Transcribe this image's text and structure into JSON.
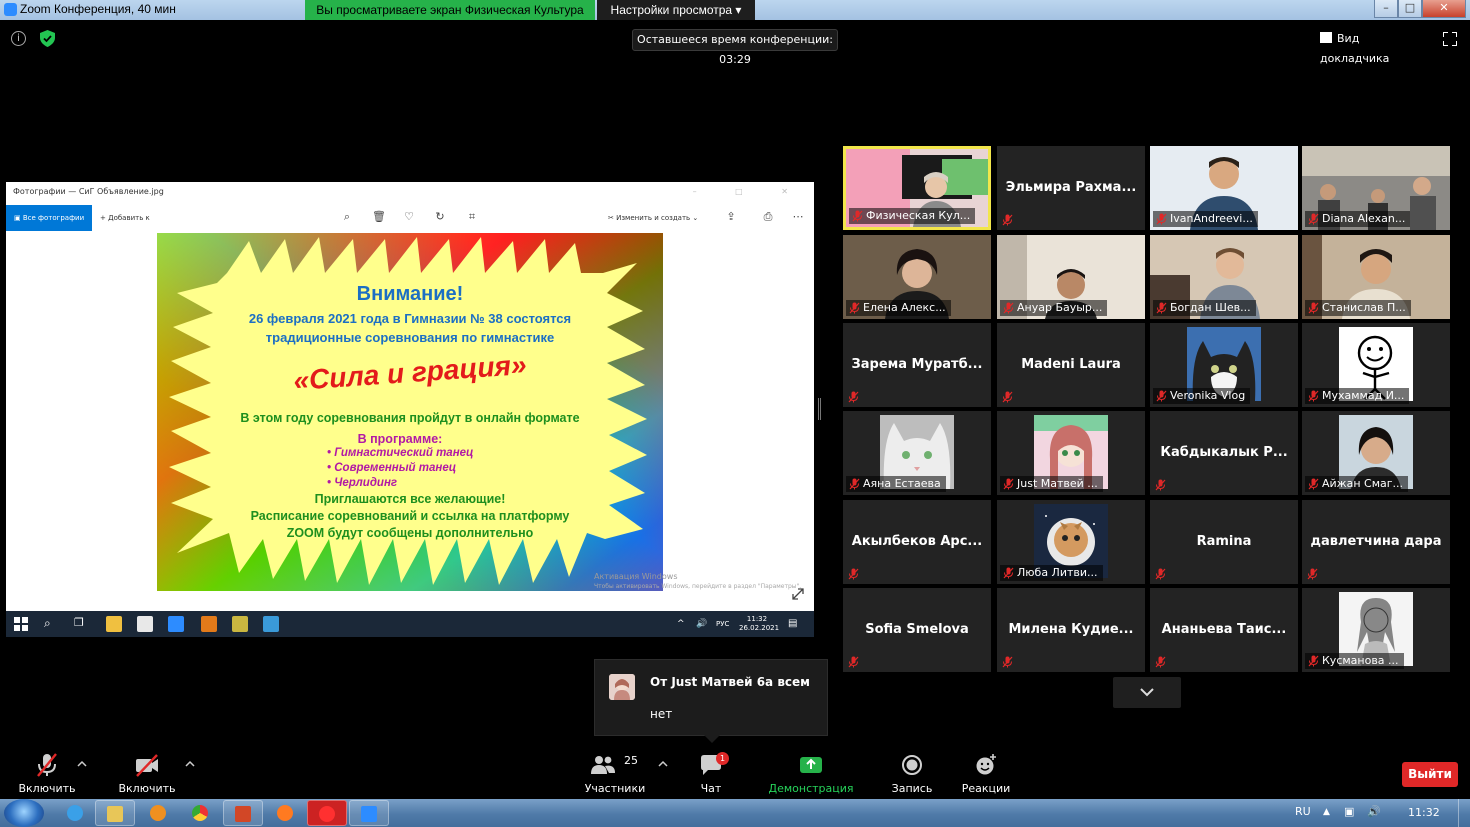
{
  "window": {
    "title": "Zoom Конференция, 40 мин",
    "share_banner": "Вы просматриваете экран Физическая Культура",
    "view_options": "Настройки просмотра"
  },
  "meeting": {
    "time_remaining": "Оставшееся время конференции: 03:29",
    "speaker_view": "Вид докладчика"
  },
  "shared_screen": {
    "photos_title": "Фотографии — СиГ Объявление.jpg",
    "all_photos": "Все фотографии",
    "add_to": "Добавить к",
    "edit_create": "Изменить и создать",
    "poster": {
      "heading": "Внимание!",
      "line1": "26 февраля 2021 года в Гимназии № 38 состоятся",
      "line2": "традиционные соревнования по гимнастике",
      "event_title": "«Сила и грация»",
      "online": "В этом году соревнования пройдут в онлайн формате",
      "program_label": "В программе:",
      "program": [
        "Гимнастический танец",
        "Современный танец",
        "Черлидинг"
      ],
      "invite": "Приглашаются все желающие!",
      "schedule1": "Расписание соревнований и ссылка на платформу",
      "schedule2": "ZOOM будут сообщены дополнительно"
    },
    "activation_line1": "Активация Windows",
    "activation_line2": "Чтобы активировать Windows, перейдите в раздел \"Параметры\".",
    "taskbar": {
      "lang": "РУС",
      "time": "11:32",
      "date": "26.02.2021"
    }
  },
  "participants": [
    {
      "label": "Физическая Кул...",
      "center": "",
      "active": true,
      "avatar": "video-teacher"
    },
    {
      "label": "",
      "center": "Эльмира  Рахма...",
      "avatar": ""
    },
    {
      "label": "IvanAndreevi...",
      "center": "",
      "avatar": "video-boy"
    },
    {
      "label": "Diana Alexan...",
      "center": "",
      "avatar": "video-room"
    },
    {
      "label": "Елена Алекс...",
      "center": "",
      "avatar": "video-woman"
    },
    {
      "label": "Ануар Бауыр...",
      "center": "",
      "avatar": "video-child"
    },
    {
      "label": "Богдан Шев...",
      "center": "",
      "avatar": "video-boy2"
    },
    {
      "label": "Станислав П...",
      "center": "",
      "avatar": "video-boy3"
    },
    {
      "label": "",
      "center": "Зарема  Муратб...",
      "avatar": ""
    },
    {
      "label": "",
      "center": "Madeni Laura",
      "avatar": ""
    },
    {
      "label": "Veronika Vlog",
      "center": "",
      "avatar": "cat-photo"
    },
    {
      "label": "Мухаммад И...",
      "center": "",
      "avatar": "smiley-drawing"
    },
    {
      "label": "Аяна Естаева",
      "center": "",
      "avatar": "white-cat-photo"
    },
    {
      "label": "Just Матвей ...",
      "center": "",
      "avatar": "anime-girl"
    },
    {
      "label": "",
      "center": "Кабдыкалык  Р...",
      "avatar": ""
    },
    {
      "label": "Айжан Смаг...",
      "center": "",
      "avatar": "woman-photo"
    },
    {
      "label": "",
      "center": "Акылбеков  Арс...",
      "avatar": ""
    },
    {
      "label": "Люба Литви...",
      "center": "",
      "avatar": "astronaut-cat"
    },
    {
      "label": "",
      "center": "Ramina",
      "avatar": ""
    },
    {
      "label": "",
      "center": "давлетчина дара",
      "avatar": ""
    },
    {
      "label": "",
      "center": "Sofia Smelova",
      "avatar": ""
    },
    {
      "label": "",
      "center": "Милена  Кудие...",
      "avatar": ""
    },
    {
      "label": "",
      "center": "Ананьева  Таис...",
      "avatar": ""
    },
    {
      "label": "Кусманова ...",
      "center": "",
      "avatar": "sketch-girl"
    }
  ],
  "chat_popup": {
    "from": "От Just Матвей 6а всем",
    "message": "нет"
  },
  "toolbar": {
    "unmute": "Включить звук",
    "start_video": "Включить видео",
    "participants": "Участники",
    "participants_count": "25",
    "chat": "Чат",
    "chat_badge": "1",
    "share_screen": "Демонстрация экрана",
    "record": "Запись",
    "reactions": "Реакции",
    "leave": "Выйти"
  },
  "os_taskbar": {
    "lang": "RU",
    "time": "11:32"
  },
  "colors": {
    "active_speaker_border": "#f2e64b",
    "share_green": "#26b24a",
    "leave_red": "#e02828",
    "poster_blue": "#1c6fc4",
    "poster_red": "#e31b1b",
    "poster_green": "#1e8f1e",
    "poster_purple": "#b21aa5"
  }
}
